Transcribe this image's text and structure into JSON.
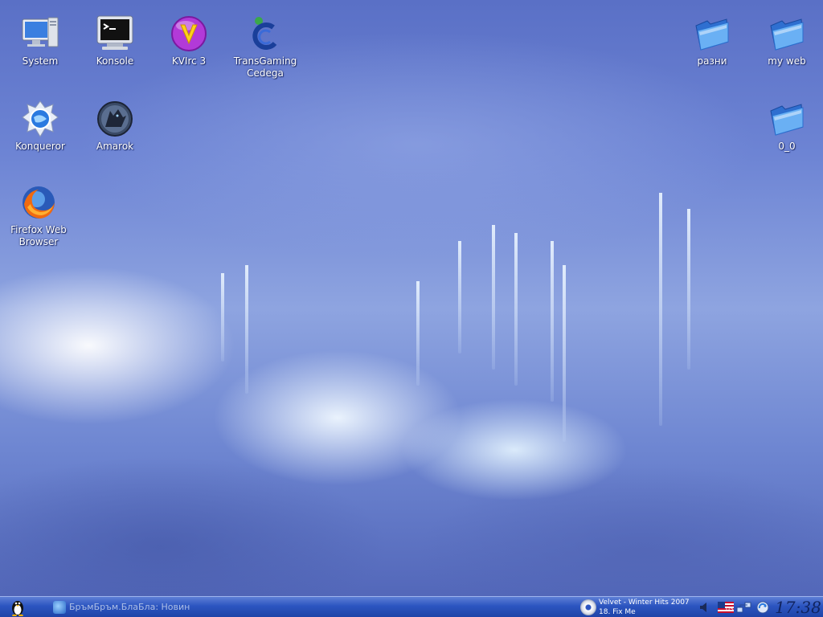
{
  "desktop": {
    "icons_left": [
      {
        "label": "System",
        "icon": "computer-icon"
      },
      {
        "label": "Konsole",
        "icon": "terminal-icon"
      },
      {
        "label": "KVIrc 3",
        "icon": "kvirc-icon"
      },
      {
        "label": "TransGaming Cedega",
        "icon": "cedega-icon"
      },
      {
        "label": "Konqueror",
        "icon": "konqueror-icon"
      },
      {
        "label": "Amarok",
        "icon": "amarok-icon"
      },
      {
        "label": "Firefox Web Browser",
        "icon": "firefox-icon"
      }
    ],
    "icons_right": [
      {
        "label": "разни",
        "icon": "folder-icon"
      },
      {
        "label": "my web",
        "icon": "folder-icon"
      },
      {
        "label": "0_0",
        "icon": "folder-icon"
      }
    ]
  },
  "taskbar": {
    "start_icon": "tux-icon",
    "task_title": "БръмБръм.БлаБла: Новин",
    "media_line1": "Velvet - Winter Hits 2007",
    "media_line2": "18. Fix Me",
    "keyboard_layout": "US",
    "clock": "17:38"
  },
  "colors": {
    "taskbar": "#2c55c0",
    "folder": "#4a8ee8",
    "kvirc": "#b23ad8"
  }
}
